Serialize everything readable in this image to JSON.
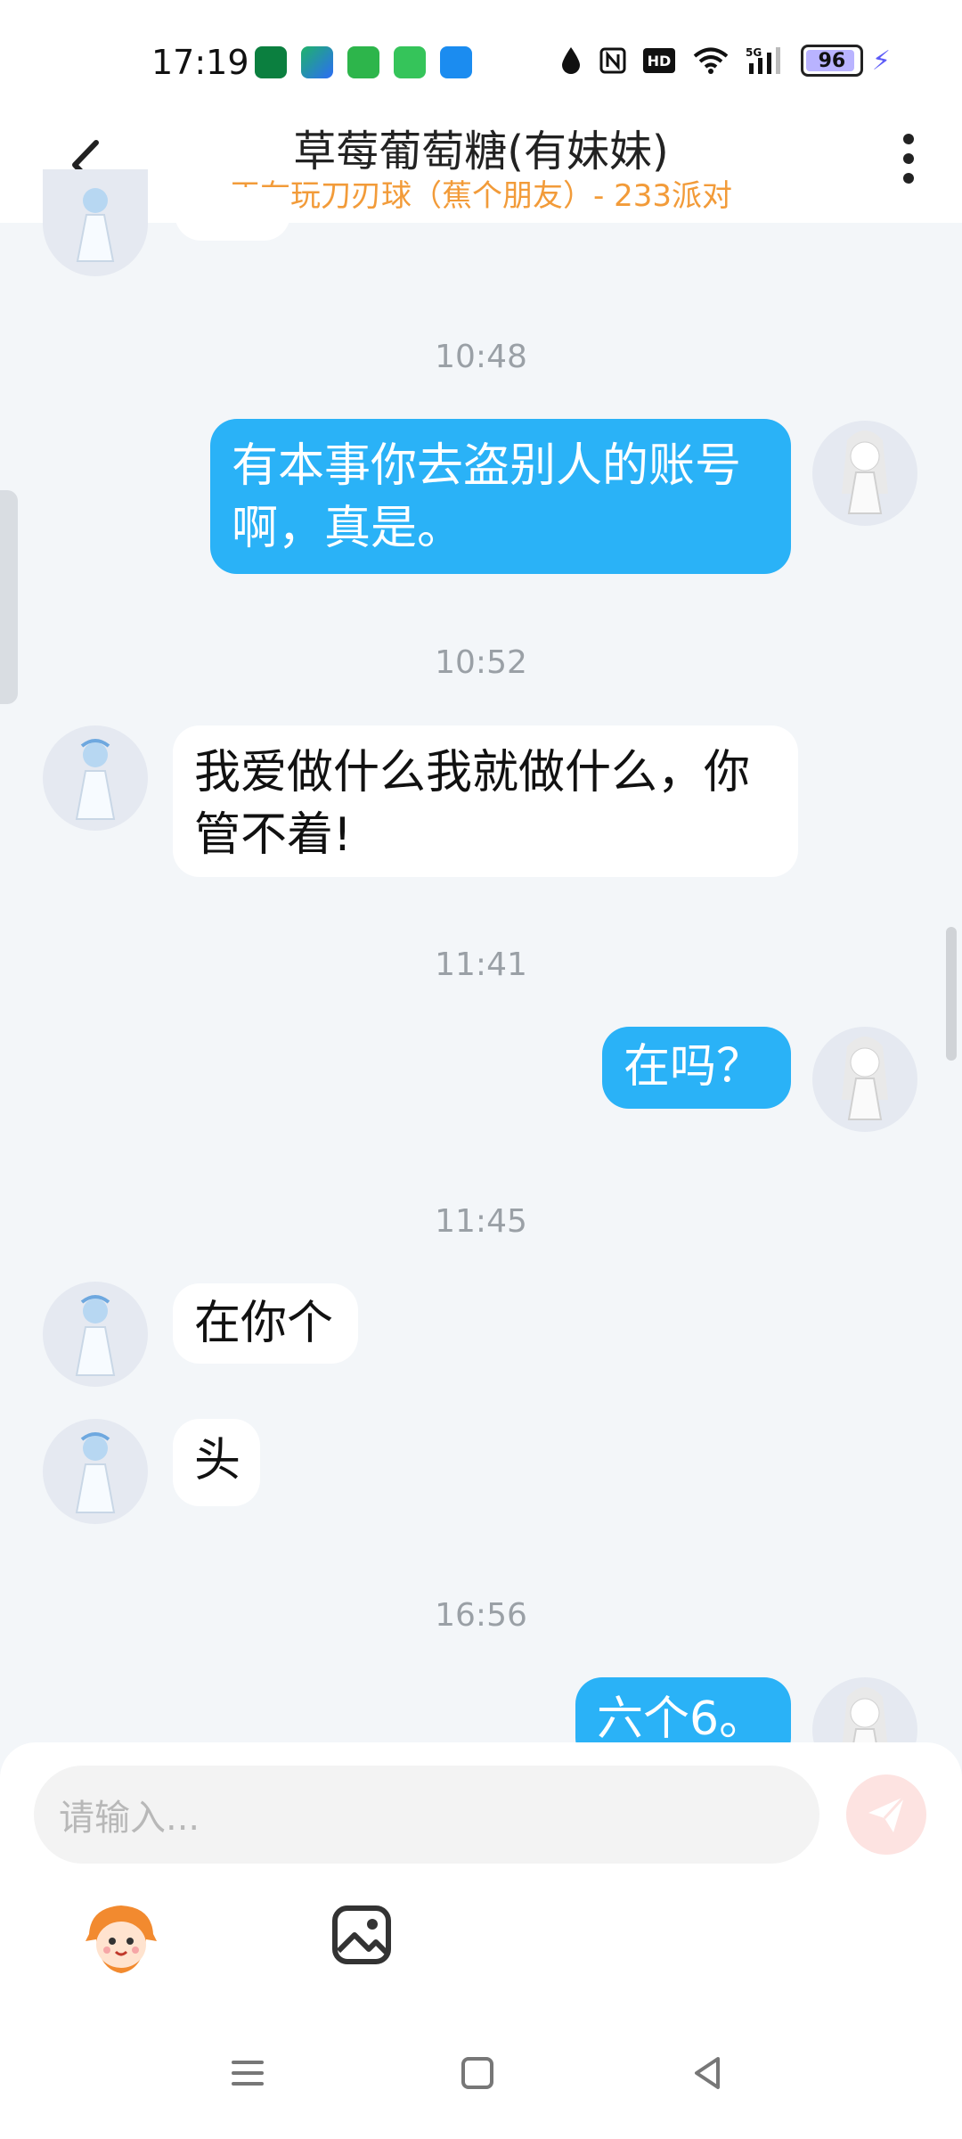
{
  "status_bar": {
    "time": "17:19",
    "battery": "96",
    "icons": [
      "oppo-app-icon",
      "game-center-icon",
      "store-icon",
      "messages-icon",
      "browser-icon",
      "drop-icon",
      "nfc-icon",
      "hd-icon",
      "wifi-icon",
      "signal-5g-icon",
      "battery-icon",
      "charging-bolt-icon"
    ]
  },
  "header": {
    "title": "草莓葡萄糖(有妹妹)",
    "subtitle": "正在玩刀刃球（蕉个朋友）- 233派对"
  },
  "chat": {
    "messages": [
      {
        "type": "time",
        "text": "10:48"
      },
      {
        "type": "out",
        "text": "有本事你去盗别人的账号啊，真是。"
      },
      {
        "type": "time",
        "text": "10:52"
      },
      {
        "type": "in",
        "text": "我爱做什么我就做什么，你管不着!"
      },
      {
        "type": "time",
        "text": "11:41"
      },
      {
        "type": "out",
        "text": "在吗？"
      },
      {
        "type": "time",
        "text": "11:45"
      },
      {
        "type": "in",
        "text": "在你个"
      },
      {
        "type": "in",
        "text": "头"
      },
      {
        "type": "time",
        "text": "16:56"
      },
      {
        "type": "out",
        "text": "六个6。"
      }
    ]
  },
  "composer": {
    "placeholder": "请输入..."
  },
  "colors": {
    "accent_blue": "#2ab2f7",
    "subtitle_orange": "#f29b39",
    "background": "#f3f6f9"
  }
}
